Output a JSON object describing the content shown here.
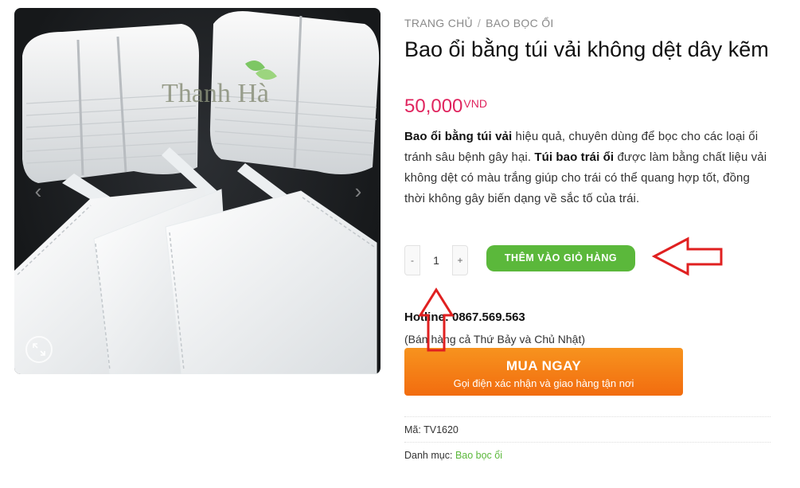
{
  "gallery": {
    "watermark": "Thanh Hà",
    "prev_icon": "chevron-left-icon",
    "next_icon": "chevron-right-icon",
    "zoom_icon": "expand-icon"
  },
  "breadcrumb": {
    "home": "TRANG CHỦ",
    "separator": "/",
    "category": "BAO BỌC ỔI"
  },
  "product": {
    "title": "Bao ổi bằng túi vải không dệt dây kẽm",
    "price": "50,000",
    "currency": "VND",
    "description": {
      "part1_bold": "Bao ổi bằng túi vải",
      "part2": " hiệu quả, chuyên dùng để bọc cho các loại ổi tránh sâu bệnh gây hại. ",
      "part3_bold": "Túi bao trái ổi",
      "part4": " được làm bằng chất liệu vải không dệt có màu trắng giúp cho trái có thể quang hợp tốt, đồng thời không gây biến dạng về sắc tố của trái."
    }
  },
  "quantity": {
    "minus": "-",
    "value": "1",
    "plus": "+"
  },
  "cart": {
    "label": "THÊM VÀO GIỎ HÀNG"
  },
  "contact": {
    "hotline": "Hotline: 0867.569.563",
    "note": "(Bán hàng cả Thứ Bảy và Chủ Nhật)"
  },
  "buy_now": {
    "label": "MUA NGAY",
    "sub": "Gọi điện xác nhận và giao hàng tận nơi"
  },
  "meta": {
    "sku_label": "Mã:",
    "sku": "TV1620",
    "category_label": "Danh mục:",
    "category": "Bao bọc ổi"
  },
  "colors": {
    "price": "#e0245e",
    "cart_button": "#5bb83b",
    "buy_button": "#f7931e",
    "annotation": "#e02020"
  }
}
